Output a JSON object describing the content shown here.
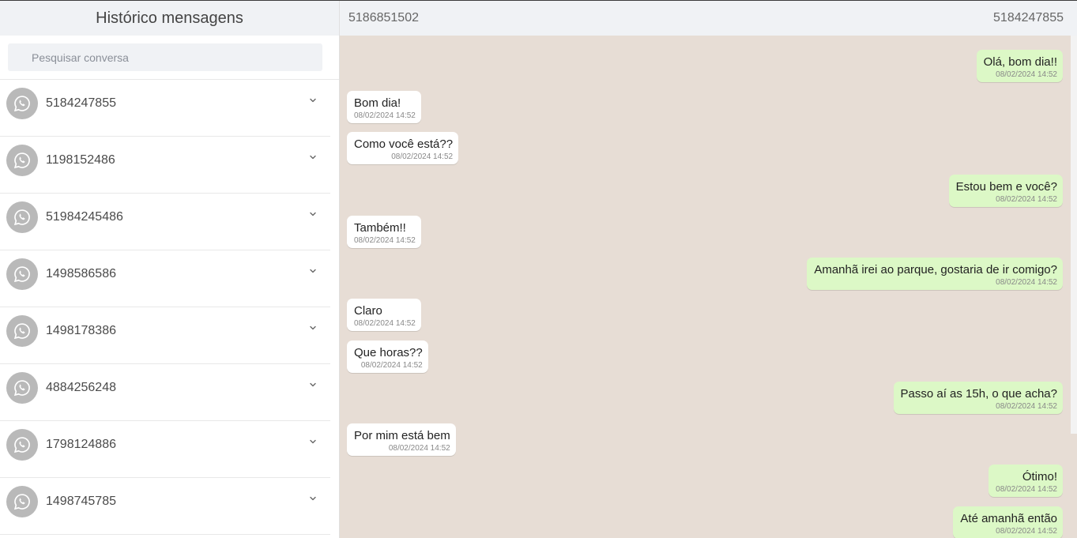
{
  "sidebar": {
    "title": "Histórico mensagens",
    "search_placeholder": "Pesquisar conversa",
    "contacts": [
      {
        "number": "5184247855"
      },
      {
        "number": "1198152486"
      },
      {
        "number": "51984245486"
      },
      {
        "number": "1498586586"
      },
      {
        "number": "1498178386"
      },
      {
        "number": "4884256248"
      },
      {
        "number": "1798124886"
      },
      {
        "number": "1498745785"
      }
    ]
  },
  "chat": {
    "header_left": "5186851502",
    "header_right": "5184247855",
    "messages": [
      {
        "dir": "out",
        "text": "Olá, bom dia!!",
        "time": "08/02/2024 14:52"
      },
      {
        "dir": "in",
        "text": "Bom dia!",
        "time": "08/02/2024 14:52"
      },
      {
        "dir": "in",
        "text": "Como você está??",
        "time": "08/02/2024 14:52"
      },
      {
        "dir": "out",
        "text": "Estou bem e você?",
        "time": "08/02/2024 14:52"
      },
      {
        "dir": "in",
        "text": "Também!!",
        "time": "08/02/2024 14:52"
      },
      {
        "dir": "out",
        "text": "Amanhã irei ao parque, gostaria de ir comigo?",
        "time": "08/02/2024 14:52"
      },
      {
        "dir": "in",
        "text": "Claro",
        "time": "08/02/2024 14:52"
      },
      {
        "dir": "in",
        "text": "Que horas??",
        "time": "08/02/2024 14:52"
      },
      {
        "dir": "out",
        "text": "Passo aí as 15h, o que acha?",
        "time": "08/02/2024 14:52"
      },
      {
        "dir": "in",
        "text": "Por mim está bem",
        "time": "08/02/2024 14:52"
      },
      {
        "dir": "out",
        "text": "Ótimo!",
        "time": "08/02/2024 14:52"
      },
      {
        "dir": "out",
        "text": "Até amanhã então",
        "time": "08/02/2024 14:52"
      }
    ]
  },
  "colors": {
    "chat_bg": "#e7ddd5",
    "outgoing_bubble": "#dcf8c6",
    "incoming_bubble": "#ffffff",
    "header_bg": "#f0f2f5",
    "avatar_bg": "#b9b9b9"
  },
  "icons": {
    "avatar": "whatsapp-icon",
    "expand": "chevron-down-icon"
  }
}
